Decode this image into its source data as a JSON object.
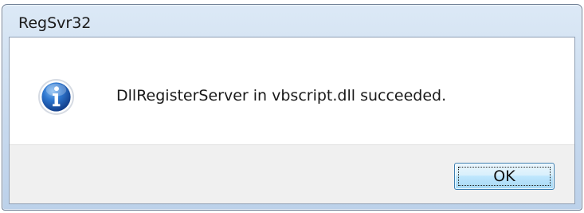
{
  "window": {
    "title": "RegSvr32"
  },
  "dialog": {
    "icon": "info-icon",
    "message": "DllRegisterServer in vbscript.dll succeeded."
  },
  "buttons": {
    "ok_label": "OK"
  },
  "colors": {
    "titlebar": "#c7d9ee",
    "icon_blue": "#1f5fb8",
    "button_border": "#3c7fb1",
    "button_bar": "#f0f0f0"
  }
}
